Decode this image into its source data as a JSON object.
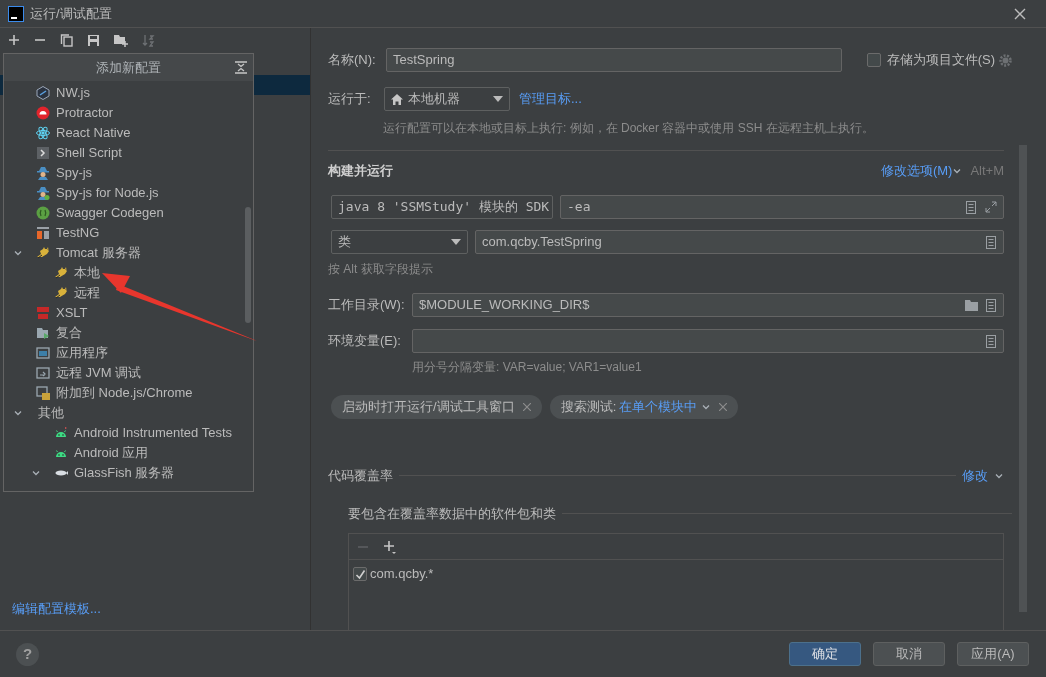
{
  "window": {
    "title": "运行/调试配置"
  },
  "popup": {
    "title": "添加新配置",
    "items": [
      {
        "label": "NW.js",
        "kind": "hexagon"
      },
      {
        "label": "Protractor",
        "kind": "dome"
      },
      {
        "label": "React Native",
        "kind": "atom"
      },
      {
        "label": "Shell Script",
        "kind": "terminal"
      },
      {
        "label": "Spy-js",
        "kind": "spy"
      },
      {
        "label": "Spy-js for Node.js",
        "kind": "spynode"
      },
      {
        "label": "Swagger Codegen",
        "kind": "swagger"
      },
      {
        "label": "TestNG",
        "kind": "testng"
      },
      {
        "label": "Tomcat 服务器",
        "kind": "cat",
        "expanded": true,
        "children": [
          {
            "label": "本地",
            "kind": "cat"
          },
          {
            "label": "远程",
            "kind": "cat"
          }
        ]
      },
      {
        "label": "XSLT",
        "kind": "xslt"
      },
      {
        "label": "复合",
        "kind": "compound"
      },
      {
        "label": "应用程序",
        "kind": "window"
      },
      {
        "label": "远程 JVM 调试",
        "kind": "remote"
      },
      {
        "label": "附加到 Node.js/Chrome",
        "kind": "attach"
      },
      {
        "label": "其他",
        "expanded": true,
        "children": [
          {
            "label": "Android Instrumented Tests",
            "kind": "androidtest"
          },
          {
            "label": "Android 应用",
            "kind": "android"
          },
          {
            "label": "GlassFish 服务器",
            "kind": "fish",
            "expanded": true
          }
        ]
      }
    ]
  },
  "edit_templates_link": "编辑配置模板...",
  "form": {
    "name_label": "名称(N):",
    "name_value": "TestSpring",
    "store_checkbox": {
      "label": "存储为项目文件(S)",
      "checked": false
    },
    "run_on_label": "运行于:",
    "run_on_value": "本地机器",
    "manage_link": "管理目标...",
    "run_on_hint": "运行配置可以在本地或目标上执行: 例如，在 Docker 容器中或使用 SSH 在远程主机上执行。",
    "section_title": "构建并运行",
    "modify_options_link": "修改选项(M)",
    "shortcut": "Alt+M",
    "sdk_select": "java 8 'SSMStudy' 模块的 SDK",
    "vm_options": "-ea",
    "type_select": "类",
    "main_class": "com.qcby.TestSpring",
    "alt_hint": "按 Alt 获取字段提示",
    "workdir_label": "工作目录(W):",
    "workdir_value": "$MODULE_WORKING_DIR$",
    "env_label": "环境变量(E):",
    "env_hint": "用分号分隔变量: VAR=value; VAR1=value1",
    "chips": [
      {
        "label": "启动时打开运行/调试工具窗口"
      },
      {
        "label": "搜索测试:",
        "value": "在单个模块中"
      }
    ],
    "coverage": {
      "title": "代码覆盖率",
      "modify_link": "修改",
      "subtitle": "要包含在覆盖率数据中的软件包和类",
      "packages": [
        {
          "label": "com.qcby.*",
          "checked": true
        }
      ]
    }
  },
  "help": "?",
  "buttons": [
    {
      "label": "确定",
      "kind": "primary"
    },
    {
      "label": "取消",
      "kind": "normal"
    },
    {
      "label": "应用(A)",
      "kind": "normal"
    }
  ]
}
